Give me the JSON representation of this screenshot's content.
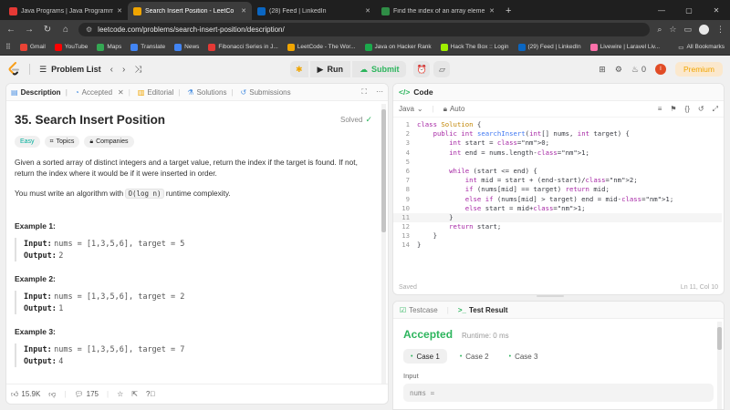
{
  "browser": {
    "tabs": [
      {
        "title": "Java Programs | Java Programmi",
        "color": "#e53935",
        "active": false
      },
      {
        "title": "Search Insert Position - LeetCo",
        "color": "#f0a500",
        "active": true
      },
      {
        "title": "(28) Feed | LinkedIn",
        "color": "#0a66c2",
        "active": false
      },
      {
        "title": "Find the index of an array eleme",
        "color": "#2f8d46",
        "active": false
      }
    ],
    "url": "leetcode.com/problems/search-insert-position/description/",
    "bookmarks": [
      {
        "label": "Gmail",
        "color": "#ea4335"
      },
      {
        "label": "YouTube",
        "color": "#ff0000"
      },
      {
        "label": "Maps",
        "color": "#34a853"
      },
      {
        "label": "Translate",
        "color": "#4285f4"
      },
      {
        "label": "News",
        "color": "#4285f4"
      },
      {
        "label": "Fibonacci Series in J...",
        "color": "#e53935"
      },
      {
        "label": "LeetCode - The Wor...",
        "color": "#f0a500"
      },
      {
        "label": "Java on Hacker Rank",
        "color": "#1ba94c"
      },
      {
        "label": "Hack The Box :: Login",
        "color": "#9fef00"
      },
      {
        "label": "(29) Feed | LinkedIn",
        "color": "#0a66c2"
      },
      {
        "label": "Livewire | Laravel Liv...",
        "color": "#fb70a9"
      }
    ],
    "all_bookmarks": "All Bookmarks"
  },
  "nav": {
    "problem_list": "Problem List",
    "run": "Run",
    "submit": "Submit",
    "streak": "0",
    "avatar_letter": "I",
    "premium": "Premium"
  },
  "left_tabs": {
    "description": "Description",
    "accepted": "Accepted",
    "editorial": "Editorial",
    "solutions": "Solutions",
    "submissions": "Submissions"
  },
  "problem": {
    "title": "35. Search Insert Position",
    "status": "Solved",
    "difficulty": "Easy",
    "topics": "Topics",
    "companies": "Companies",
    "para1": "Given a sorted array of distinct integers and a target value, return the index if the target is found. If not, return the index where it would be if it were inserted in order.",
    "para2_pre": "You must write an algorithm with ",
    "para2_code": "O(log n)",
    "para2_post": " runtime complexity.",
    "examples": [
      {
        "title": "Example 1:",
        "input": "nums = [1,3,5,6], target = 5",
        "output": "2"
      },
      {
        "title": "Example 2:",
        "input": "nums = [1,3,5,6], target = 2",
        "output": "1"
      },
      {
        "title": "Example 3:",
        "input": "nums = [1,3,5,6], target = 7",
        "output": "4"
      }
    ],
    "input_label": "Input:",
    "output_label": "Output:"
  },
  "footer": {
    "likes": "15.9K",
    "comments": "175"
  },
  "code": {
    "header": "Code",
    "language": "Java",
    "auto": "Auto",
    "saved": "Saved",
    "cursor": "Ln 11, Col 10",
    "lines": [
      "class Solution {",
      "    public int searchInsert(int[] nums, int target) {",
      "        int start = 0;",
      "        int end = nums.length-1;",
      "",
      "        while (start <= end) {",
      "            int mid = start + (end-start)/2;",
      "            if (nums[mid] == target) return mid;",
      "            else if (nums[mid] > target) end = mid-1;",
      "            else start = mid+1;",
      "        }",
      "        return start;",
      "    }",
      "}"
    ],
    "highlight_line": 11
  },
  "tests": {
    "testcase_tab": "Testcase",
    "result_tab": "Test Result",
    "verdict": "Accepted",
    "runtime": "Runtime: 0 ms",
    "cases": [
      "Case 1",
      "Case 2",
      "Case 3"
    ],
    "input_label": "Input",
    "input_preview": "nums ="
  }
}
